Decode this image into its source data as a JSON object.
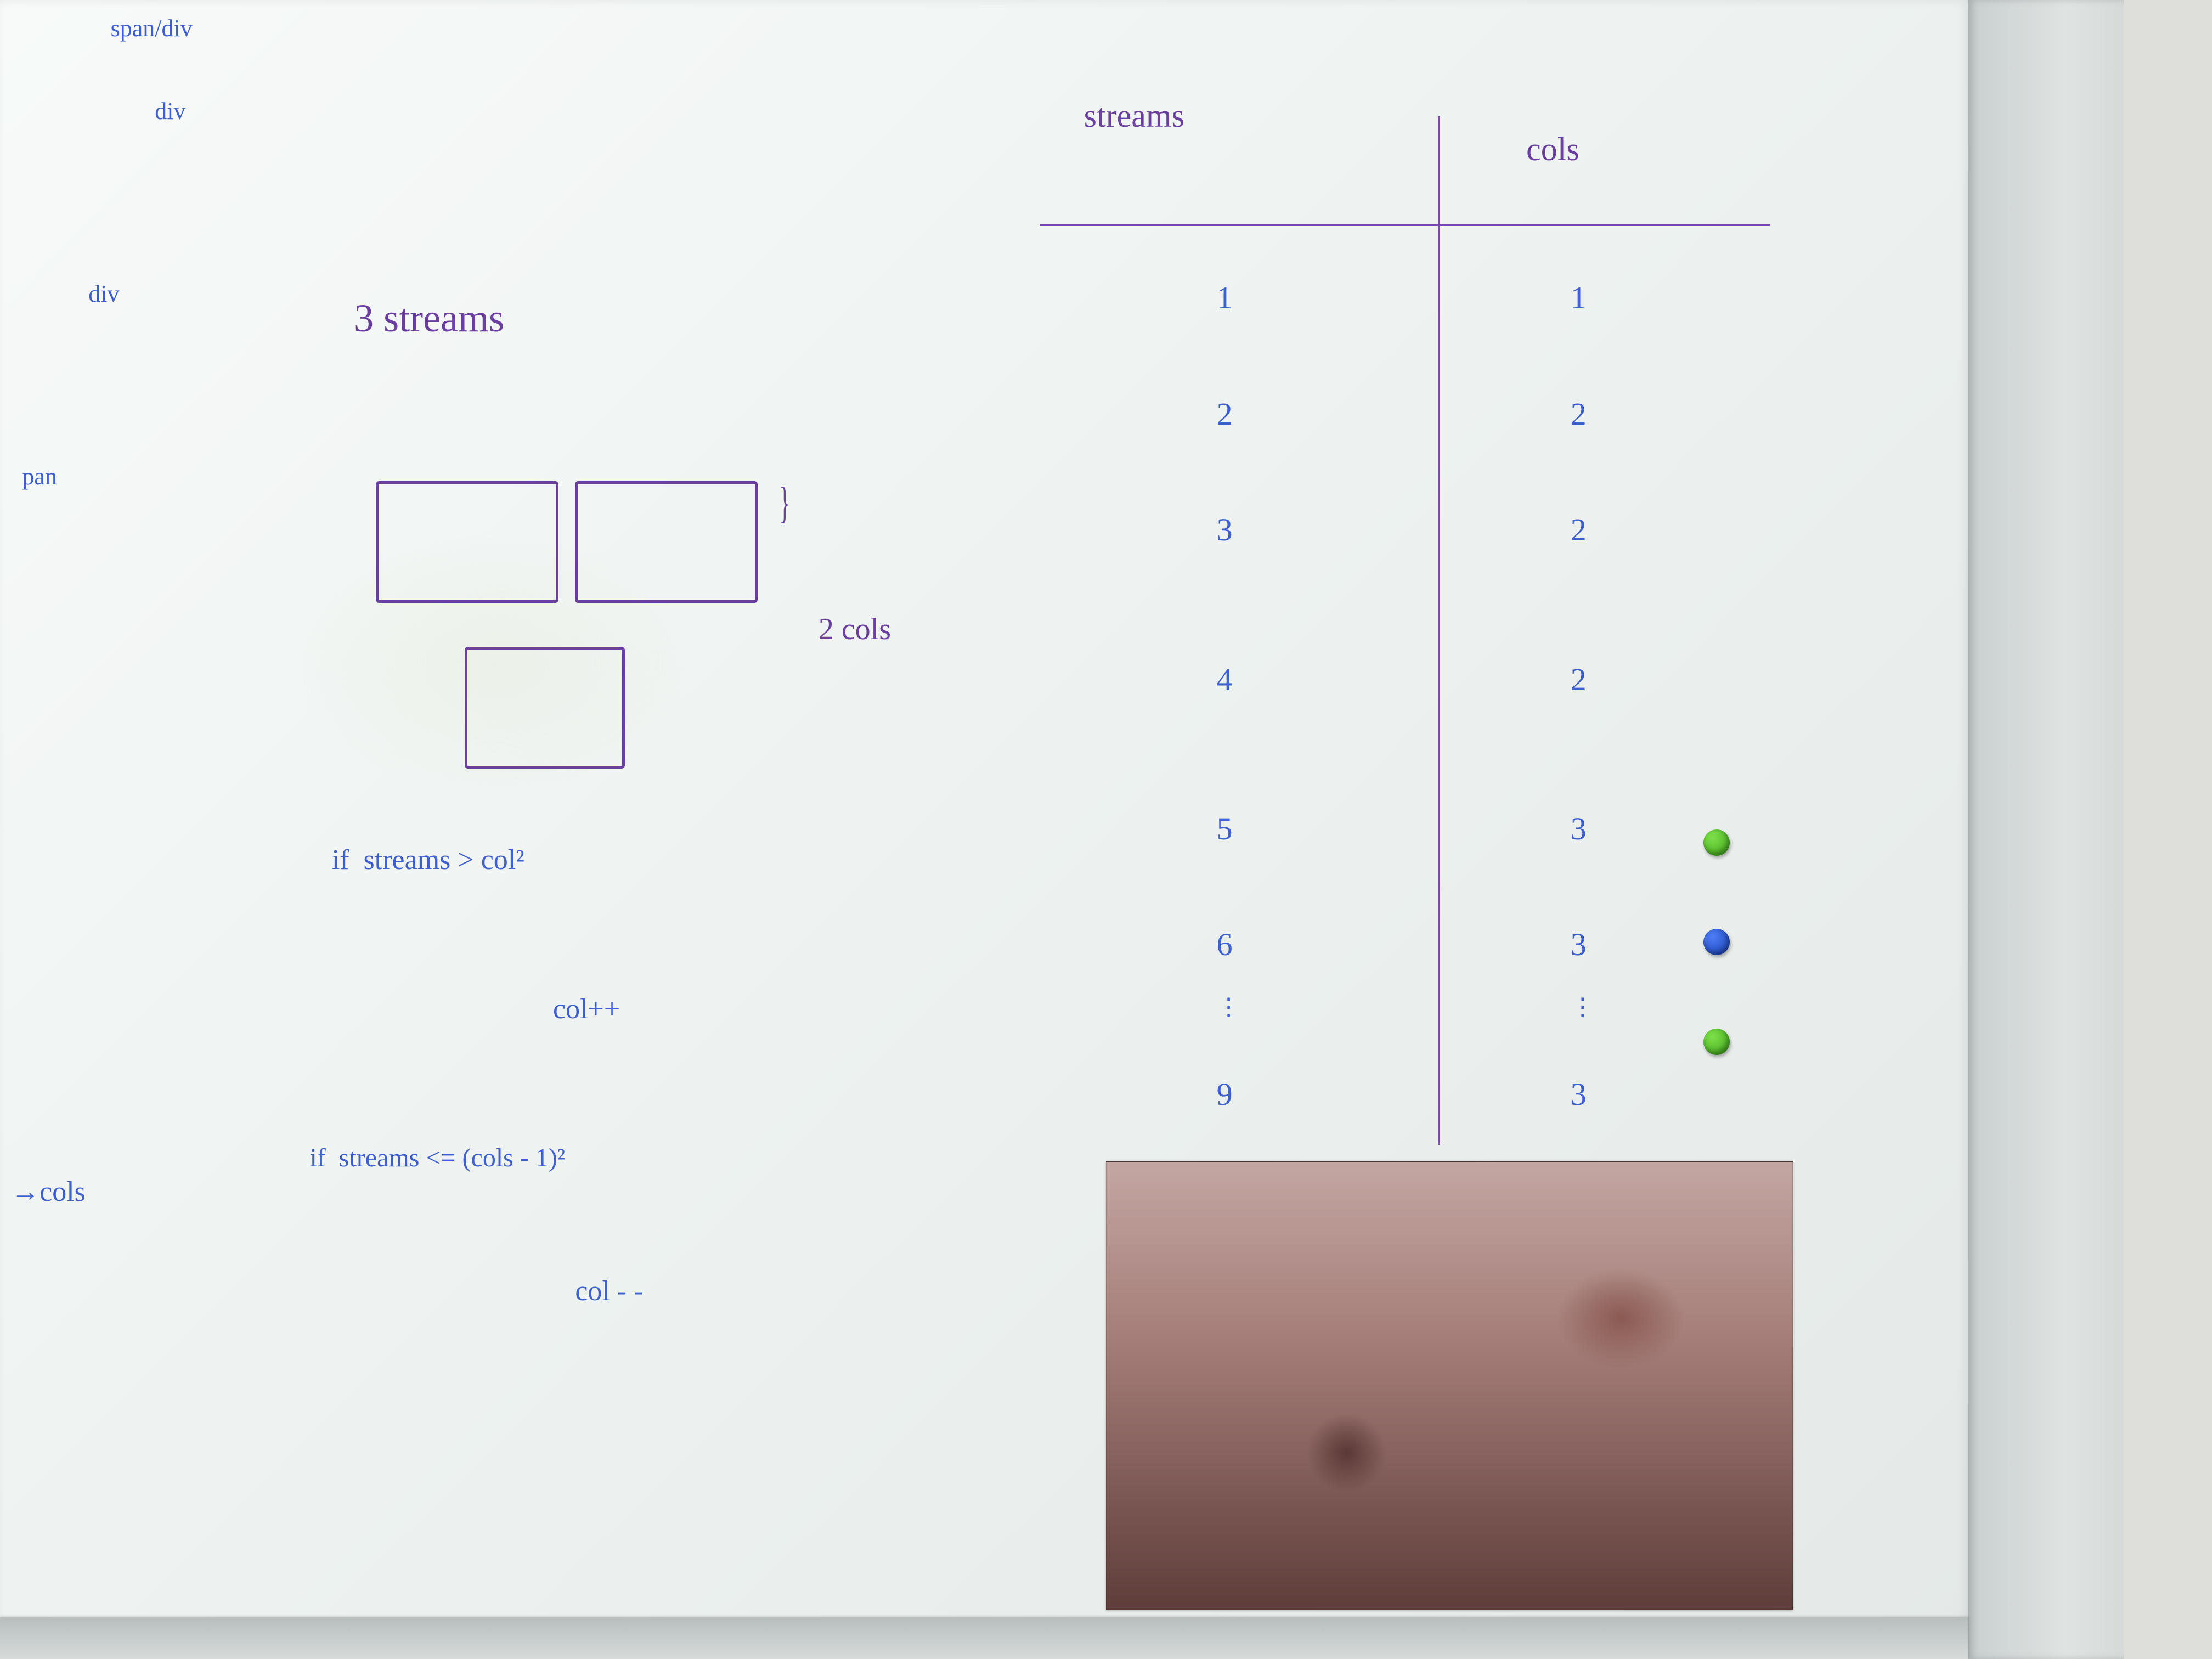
{
  "top_left_labels": {
    "l1": "span/div",
    "l2": "div",
    "l3": "div",
    "l4": "pan",
    "l5": "→cols"
  },
  "diagram": {
    "title": "3 streams",
    "annotation": "2 cols"
  },
  "conditions": {
    "c1_line1": "if  streams > col²",
    "c1_line2": "col++",
    "c2_line1": "if  streams <= (cols - 1)²",
    "c2_line2": "col - -"
  },
  "table": {
    "head_streams": "streams",
    "head_cols": "cols",
    "rows": [
      {
        "streams": "1",
        "cols": "1"
      },
      {
        "streams": "2",
        "cols": "2"
      },
      {
        "streams": "3",
        "cols": "2"
      },
      {
        "streams": "4",
        "cols": "2"
      },
      {
        "streams": "5",
        "cols": "3"
      },
      {
        "streams": "6",
        "cols": "3"
      }
    ],
    "ellipsis": "⋮",
    "last": {
      "streams": "9",
      "cols": "3"
    }
  }
}
